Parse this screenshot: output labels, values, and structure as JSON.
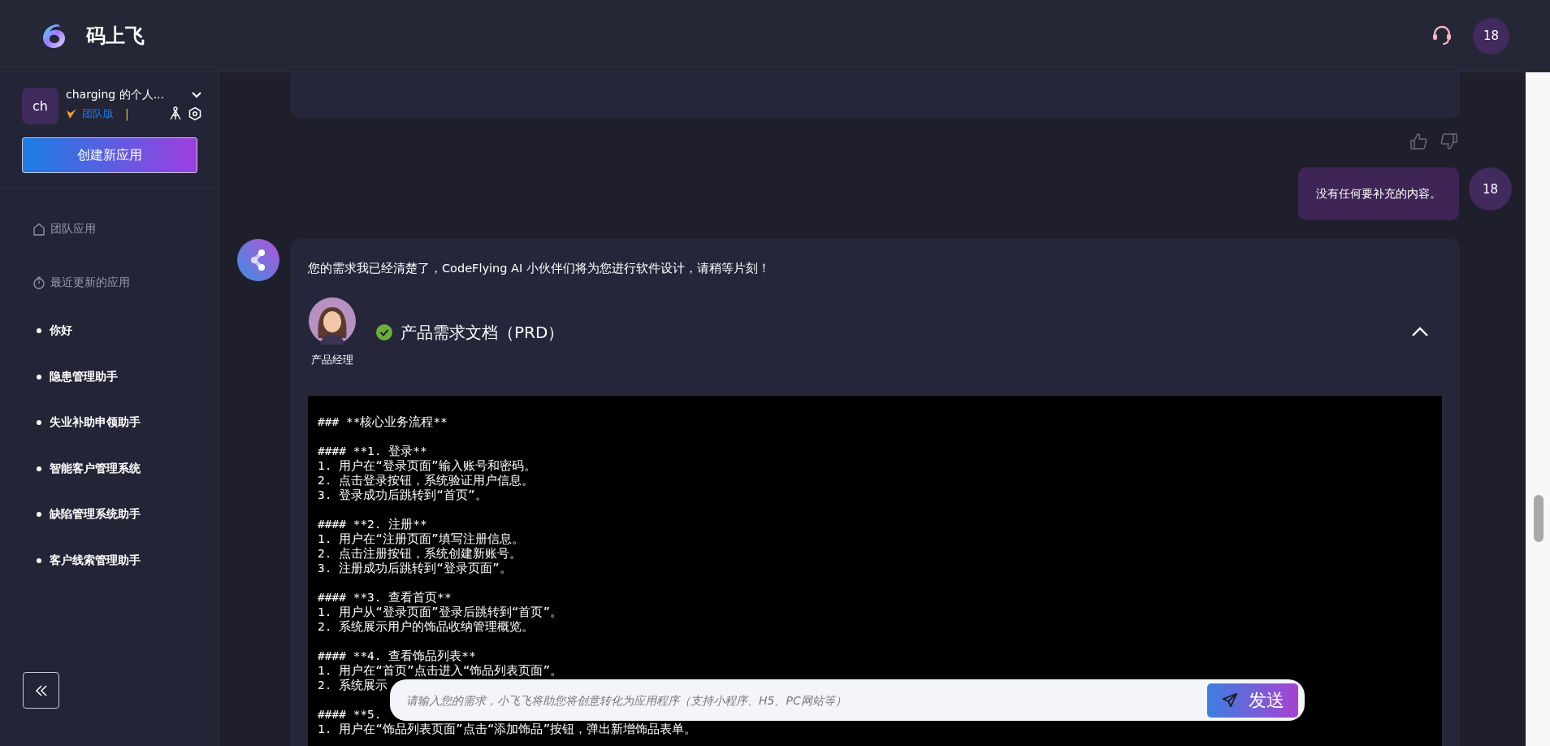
{
  "header": {
    "app_name": "码上飞",
    "user_avatar": "18"
  },
  "sidebar": {
    "workspace": {
      "avatar": "ch",
      "name": "charging 的个人...",
      "plan": "团队版",
      "separator": "|"
    },
    "create_button": "创建新应用",
    "team_apps": "团队应用",
    "recent_header": "最近更新的应用",
    "recent_apps": [
      "你好",
      "隐患管理助手",
      "失业补助申领助手",
      "智能客户管理系统",
      "缺陷管理系统助手",
      "客户线索管理助手"
    ]
  },
  "chat": {
    "user_message": {
      "text": "没有任何要补充的内容。",
      "avatar": "18"
    },
    "bot_message": {
      "text": "您的需求我已经清楚了，CodeFlying AI 小伙伴们将为您进行软件设计，请稍等片刻！",
      "document": {
        "role": "产品经理",
        "title": "产品需求文档（PRD）",
        "done": true,
        "expanded": true,
        "code_title": "### **核心业务流程**",
        "sections": [
          {
            "heading": "#### **1. 登录**",
            "steps": [
              "1. 用户在“登录页面”输入账号和密码。",
              "2. 点击登录按钮，系统验证用户信息。",
              "3. 登录成功后跳转到“首页”。"
            ]
          },
          {
            "heading": "#### **2. 注册**",
            "steps": [
              "1. 用户在“注册页面”填写注册信息。",
              "2. 点击注册按钮，系统创建新账号。",
              "3. 注册成功后跳转到“登录页面”。"
            ]
          },
          {
            "heading": "#### **3. 查看首页**",
            "steps": [
              "1. 用户从“登录页面”登录后跳转到“首页”。",
              "2. 系统展示用户的饰品收纳管理概览。"
            ]
          },
          {
            "heading": "#### **4. 查看饰品列表**",
            "steps": [
              "1. 用户在“首页”点击进入“饰品列表页面”。",
              "2. 系统展示"
            ]
          },
          {
            "heading": "#### **5.",
            "steps": [
              "1. 用户在“饰品列表页面”点击“添加饰品”按钮，弹出新增饰品表单。"
            ]
          }
        ]
      }
    }
  },
  "input": {
    "placeholder": "请输入您的需求，小飞飞将助您将创意转化为应用程序（支持小程序、H5、PC网站等）",
    "send_button": "发送"
  }
}
